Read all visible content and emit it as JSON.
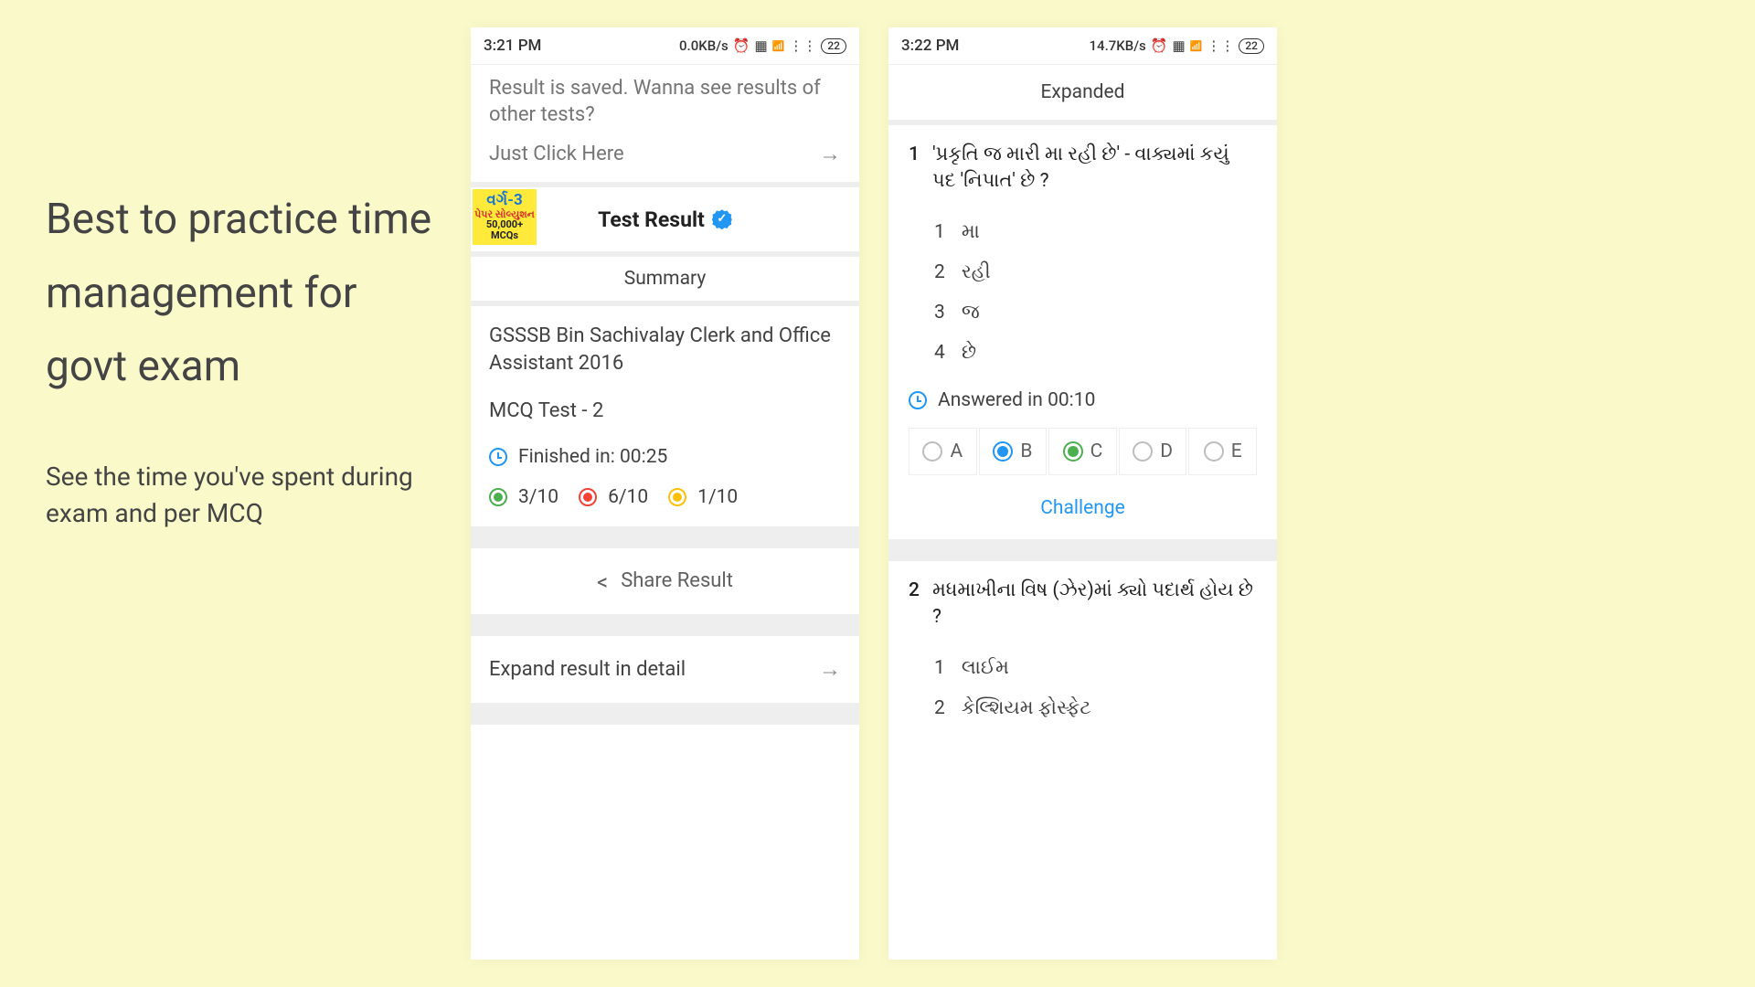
{
  "text_panel": {
    "headline": "Best to practice time management for govt exam",
    "sub": "See the time you've spent during exam and per MCQ"
  },
  "phone1": {
    "status": {
      "time": "3:21 PM",
      "speed": "0.0KB/s",
      "battery": "22"
    },
    "notice": "Result is saved. Wanna see results of other tests?",
    "click_here": "Just Click Here",
    "badge": {
      "l1": "વર્ગ-3",
      "l2": "પેપર સોલ્યુશન",
      "l3": "50,000+ MCQs"
    },
    "test_result": "Test Result",
    "summary": "Summary",
    "exam_name": "GSSSB Bin Sachivalay Clerk and Office Assistant 2016",
    "test_name": "MCQ Test - 2",
    "finished": "Finished in: 00:25",
    "scores": {
      "correct": "3/10",
      "wrong": "6/10",
      "skipped": "1/10"
    },
    "share": "Share Result",
    "expand": "Expand result in detail"
  },
  "phone2": {
    "status": {
      "time": "3:22 PM",
      "speed": "14.7KB/s",
      "battery": "22"
    },
    "expanded": "Expanded",
    "q1": {
      "num": "1",
      "text": "'પ્રકૃતિ જ મારી મા રહી છે' - વાક્યમાં કયું પદ 'નિપાત' છે ?",
      "options": [
        {
          "n": "1",
          "t": "મા"
        },
        {
          "n": "2",
          "t": "રહી"
        },
        {
          "n": "3",
          "t": "જ"
        },
        {
          "n": "4",
          "t": "છે"
        }
      ],
      "answered": "Answered in 00:10",
      "choices": [
        "A",
        "B",
        "C",
        "D",
        "E"
      ],
      "challenge": "Challenge"
    },
    "q2": {
      "num": "2",
      "text": "મધમાખીના વિષ (ઝેર)માં ક્યો પદાર્થ હોય છે ?",
      "options": [
        {
          "n": "1",
          "t": "લાઈમ"
        },
        {
          "n": "2",
          "t": "કેલ્શિયમ ફોસ્ફેટ"
        }
      ]
    }
  }
}
